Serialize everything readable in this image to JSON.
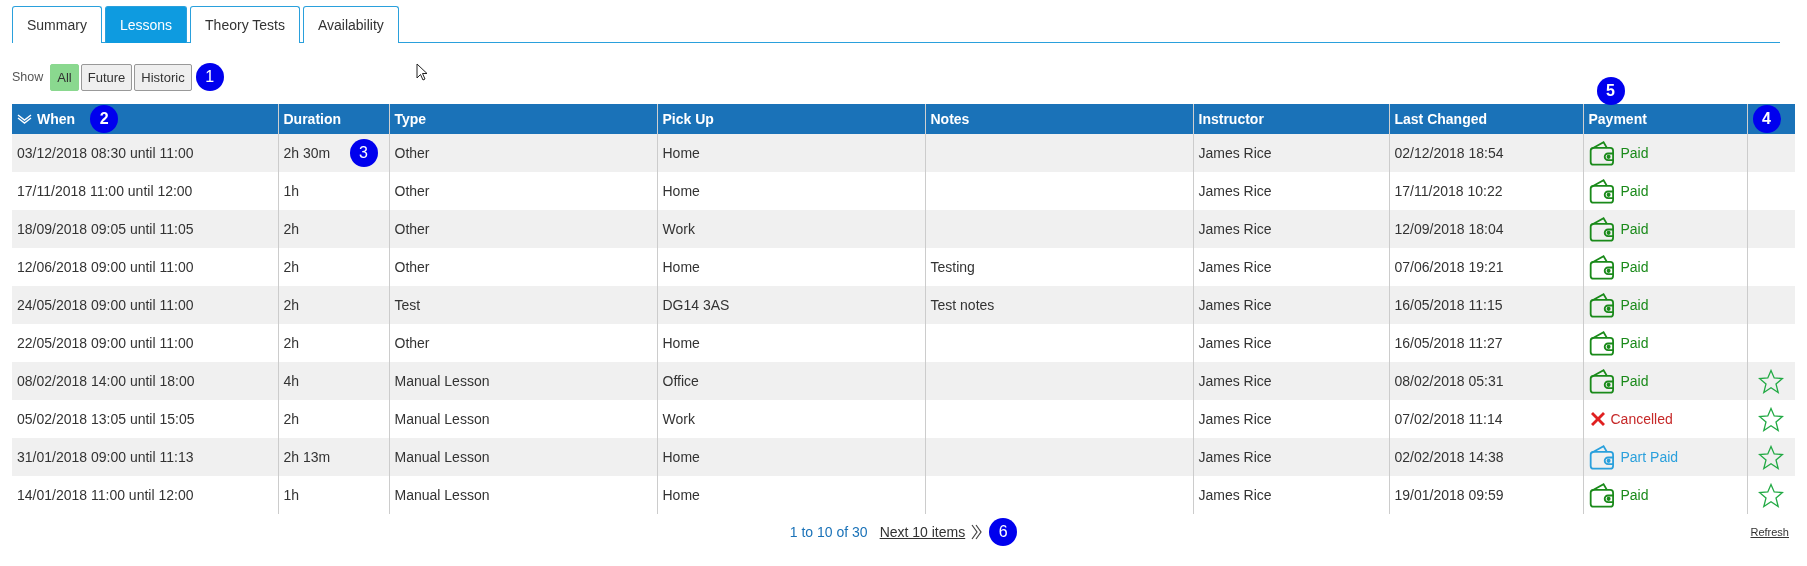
{
  "tabs": [
    {
      "label": "Summary",
      "selected": false
    },
    {
      "label": "Lessons",
      "selected": true
    },
    {
      "label": "Theory Tests",
      "selected": false
    },
    {
      "label": "Availability",
      "selected": false
    }
  ],
  "filter": {
    "label": "Show",
    "marker": "1",
    "options": [
      {
        "label": "All",
        "selected": true
      },
      {
        "label": "Future",
        "selected": false
      },
      {
        "label": "Historic",
        "selected": false
      }
    ]
  },
  "table": {
    "columns": [
      {
        "label": "When",
        "sorted": true,
        "marker": "2"
      },
      {
        "label": "Duration"
      },
      {
        "label": "Type"
      },
      {
        "label": "Pick Up"
      },
      {
        "label": "Notes"
      },
      {
        "label": "Instructor"
      },
      {
        "label": "Last Changed"
      },
      {
        "label": "Payment",
        "marker": "5"
      },
      {
        "marker": "4"
      }
    ],
    "rows": [
      {
        "when": "03/12/2018 08:30 until 11:00",
        "duration": "2h 30m",
        "duration_marker": "3",
        "type": "Other",
        "pickup": "Home",
        "notes": "",
        "instructor": "James Rice",
        "changed": "02/12/2018 18:54",
        "payment": {
          "kind": "paid",
          "label": "Paid"
        },
        "star": false
      },
      {
        "when": "17/11/2018 11:00 until 12:00",
        "duration": "1h",
        "type": "Other",
        "pickup": "Home",
        "notes": "",
        "instructor": "James Rice",
        "changed": "17/11/2018 10:22",
        "payment": {
          "kind": "paid",
          "label": "Paid"
        },
        "star": false
      },
      {
        "when": "18/09/2018 09:05 until 11:05",
        "duration": "2h",
        "type": "Other",
        "pickup": "Work",
        "notes": "",
        "instructor": "James Rice",
        "changed": "12/09/2018 18:04",
        "payment": {
          "kind": "paid",
          "label": "Paid"
        },
        "star": false
      },
      {
        "when": "12/06/2018 09:00 until 11:00",
        "duration": "2h",
        "type": "Other",
        "pickup": "Home",
        "notes": "Testing",
        "instructor": "James Rice",
        "changed": "07/06/2018 19:21",
        "payment": {
          "kind": "paid",
          "label": "Paid"
        },
        "star": false
      },
      {
        "when": "24/05/2018 09:00 until 11:00",
        "duration": "2h",
        "type": "Test",
        "pickup": "DG14 3AS",
        "notes": "Test notes",
        "instructor": "James Rice",
        "changed": "16/05/2018 11:15",
        "payment": {
          "kind": "paid",
          "label": "Paid"
        },
        "star": false
      },
      {
        "when": "22/05/2018 09:00 until 11:00",
        "duration": "2h",
        "type": "Other",
        "pickup": "Home",
        "notes": "",
        "instructor": "James Rice",
        "changed": "16/05/2018 11:27",
        "payment": {
          "kind": "paid",
          "label": "Paid"
        },
        "star": false
      },
      {
        "when": "08/02/2018 14:00 until 18:00",
        "duration": "4h",
        "type": "Manual Lesson",
        "pickup": "Office",
        "notes": "",
        "instructor": "James Rice",
        "changed": "08/02/2018 05:31",
        "payment": {
          "kind": "paid",
          "label": "Paid"
        },
        "star": true
      },
      {
        "when": "05/02/2018 13:05 until 15:05",
        "duration": "2h",
        "type": "Manual Lesson",
        "pickup": "Work",
        "notes": "",
        "instructor": "James Rice",
        "changed": "07/02/2018 11:14",
        "payment": {
          "kind": "cancelled",
          "label": "Cancelled"
        },
        "star": true
      },
      {
        "when": "31/01/2018 09:00 until 11:13",
        "duration": "2h 13m",
        "type": "Manual Lesson",
        "pickup": "Home",
        "notes": "",
        "instructor": "James Rice",
        "changed": "02/02/2018 14:38",
        "payment": {
          "kind": "part_paid",
          "label": "Part Paid"
        },
        "star": true
      },
      {
        "when": "14/01/2018 11:00 until 12:00",
        "duration": "1h",
        "type": "Manual Lesson",
        "pickup": "Home",
        "notes": "",
        "instructor": "James Rice",
        "changed": "19/01/2018 09:59",
        "payment": {
          "kind": "paid",
          "label": "Paid"
        },
        "star": true
      }
    ]
  },
  "pager": {
    "range": "1 to 10 of 30",
    "next": "Next 10 items",
    "marker": "6"
  },
  "refresh": "Refresh"
}
